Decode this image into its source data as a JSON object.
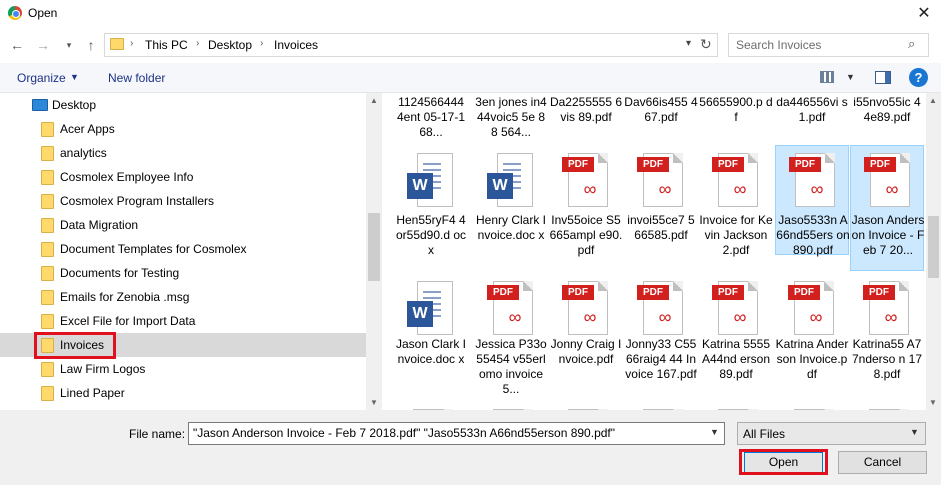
{
  "window": {
    "title": "Open",
    "close_glyph": "✕"
  },
  "address": {
    "crumbs": [
      "This PC",
      "Desktop",
      "Invoices"
    ],
    "search_placeholder": "Search Invoices"
  },
  "toolbar": {
    "organize": "Organize",
    "new_folder": "New folder",
    "help": "?"
  },
  "nav": {
    "items": [
      "Desktop",
      "Acer Apps",
      "analytics",
      "Cosmolex Employee Info",
      "Cosmolex Program Installers",
      "Data Migration",
      "Document Templates for Cosmolex",
      "Documents for Testing",
      "Emails for Zenobia .msg",
      "Excel File for Import Data",
      "Invoices",
      "Law Firm Logos",
      "Lined Paper"
    ],
    "selected": "Invoices"
  },
  "files": {
    "row0": [
      {
        "name": "1124566444 4ent 05-17-168..."
      },
      {
        "name": "3en jones in444voic5 5e 88 564..."
      },
      {
        "name": "Da2255555 6vis 89.pdf"
      },
      {
        "name": "Dav66is455 467.pdf"
      },
      {
        "name": "56655900.p df"
      },
      {
        "name": "da446556vi s 1.pdf"
      },
      {
        "name": "i55nvo55ic 44e89.pdf"
      }
    ],
    "row1": [
      {
        "name": "Hen55ryF4 4or55d90.d ocx",
        "type": "word"
      },
      {
        "name": "Henry Clark Invoice.doc x",
        "type": "word"
      },
      {
        "name": "Inv55oice S5665ampl e90.pdf",
        "type": "pdf"
      },
      {
        "name": "invoi55ce7 566585.pdf",
        "type": "pdf"
      },
      {
        "name": "Invoice for Kevin Jackson 2.pdf",
        "type": "pdf"
      },
      {
        "name": "Jaso5533n A66nd55ers on 890.pdf",
        "type": "pdf",
        "selected": true
      },
      {
        "name": "Jason Anderson Invoice - Feb 7 20...",
        "type": "pdf",
        "selected": true
      }
    ],
    "row2": [
      {
        "name": "Jason Clark Invoice.doc x",
        "type": "word"
      },
      {
        "name": "Jessica P33o55454 v55erlomo invoice 5...",
        "type": "pdf"
      },
      {
        "name": "Jonny Craig Invoice.pdf",
        "type": "pdf"
      },
      {
        "name": "Jonny33 C5566raig4 44 Invoice 167.pdf",
        "type": "pdf"
      },
      {
        "name": "Katrina 5555A44nd erson 89.pdf",
        "type": "pdf"
      },
      {
        "name": "Katrina Anderson Invoice.pdf",
        "type": "pdf"
      },
      {
        "name": "Katrina55 A77nderso n 178.pdf",
        "type": "pdf"
      }
    ],
    "pdf_label": "PDF",
    "word_label": "W"
  },
  "bottom": {
    "file_name_label": "File name:",
    "file_name_value": "\"Jason Anderson Invoice - Feb 7 2018.pdf\" \"Jaso5533n A66nd55erson 890.pdf\"",
    "filter": "All Files",
    "open": "Open",
    "cancel": "Cancel"
  },
  "colors": {
    "accent": "#0078d7",
    "highlight": "#e0101f",
    "pdf": "#d2201e",
    "word": "#2b579a"
  }
}
